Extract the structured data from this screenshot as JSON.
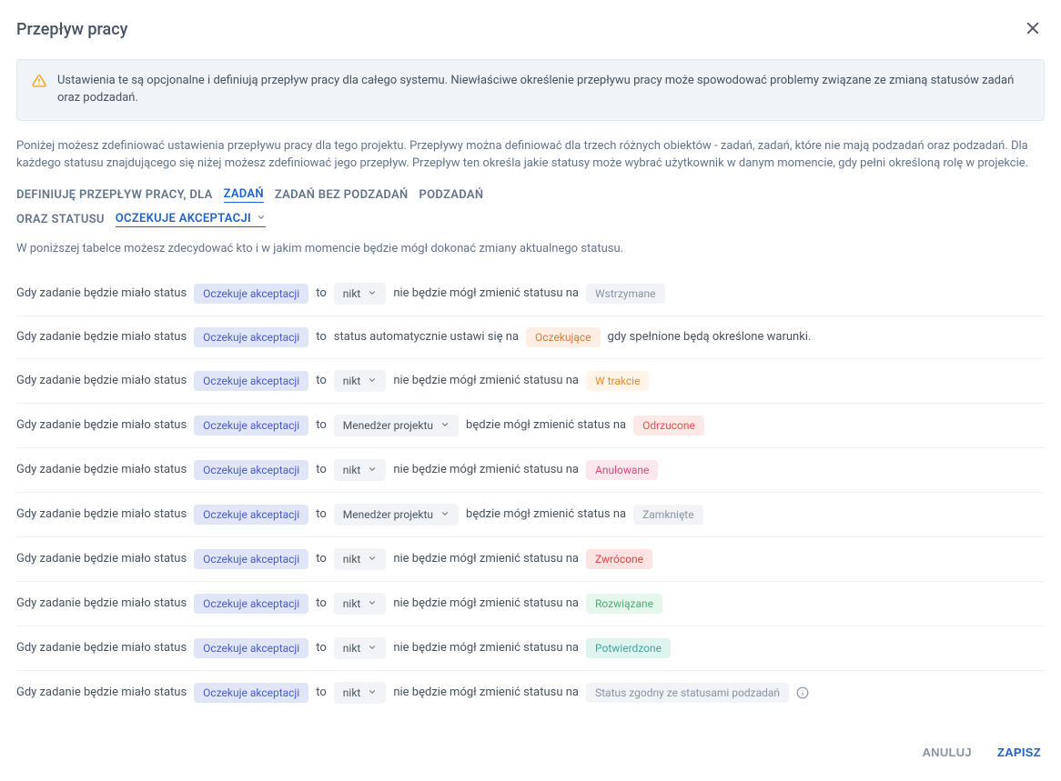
{
  "modal": {
    "title": "Przepływ pracy",
    "alert": "Ustawienia te są opcjonalne i definiują przepływ pracy dla całego systemu. Niewłaściwe określenie przepływu pracy może spowodować problemy związane ze zmianą statusów zadań oraz podzadań.",
    "description": "Poniżej możesz zdefiniować ustawienia przepływu pracy dla tego projektu. Przepływy można definiować dla trzech różnych obiektów - zadań, zadań, które nie mają podzadań oraz podzadań. Dla każdego statusu znajdującego się niżej możesz zdefiniować jego przepływ. Przepływ ten określa jakie statusy może wybrać użytkownik w danym momencie, gdy pełni określoną rolę w projekcie.",
    "define_label": "DEFINIUJĘ PRZEPŁYW PRACY, DLA",
    "tabs": {
      "tasks": "ZADAŃ",
      "tasks_no_sub": "ZADAŃ BEZ PODZADAŃ",
      "subtasks": "PODZADAŃ"
    },
    "status_label": "ORAZ STATUSU",
    "status_selected": "OCZEKUJE AKCEPTACJI",
    "table_description": "W poniższej tabelce możesz zdecydować kto i w jakim momencie będzie mógł dokonać zmiany aktualnego statusu.",
    "rule_prefix": "Gdy zadanie będzie miało status",
    "source_status": "Oczekuje akceptacji",
    "to_word": "to",
    "phrase_nobody": "nie będzie mógł zmienić statusu na",
    "phrase_can": "będzie mógł zmienić status na",
    "auto_phrase_pre": "status automatycznie ustawi się na",
    "auto_phrase_post": "gdy spełnione będą określone warunki.",
    "roles": {
      "nobody": "nikt",
      "pm": "Menedżer projektu"
    },
    "rows": [
      {
        "type": "nobody",
        "target": "Wstrzymane",
        "badgeClass": "badge-gray"
      },
      {
        "type": "auto",
        "target": "Oczekujące",
        "badgeClass": "badge-orange-light"
      },
      {
        "type": "nobody",
        "target": "W trakcie",
        "badgeClass": "badge-orange"
      },
      {
        "type": "pm",
        "target": "Odrzucone",
        "badgeClass": "badge-red-light"
      },
      {
        "type": "nobody",
        "target": "Anulowane",
        "badgeClass": "badge-pink"
      },
      {
        "type": "pm",
        "target": "Zamknięte",
        "badgeClass": "badge-gray"
      },
      {
        "type": "nobody",
        "target": "Zwrócone",
        "badgeClass": "badge-red"
      },
      {
        "type": "nobody",
        "target": "Rozwiązane",
        "badgeClass": "badge-green-light"
      },
      {
        "type": "nobody",
        "target": "Potwierdzone",
        "badgeClass": "badge-teal"
      },
      {
        "type": "nobody",
        "target": "Status zgodny ze statusami podzadań",
        "badgeClass": "badge-gray",
        "info": true
      }
    ],
    "footer": {
      "cancel": "ANULUJ",
      "save": "ZAPISZ"
    }
  }
}
